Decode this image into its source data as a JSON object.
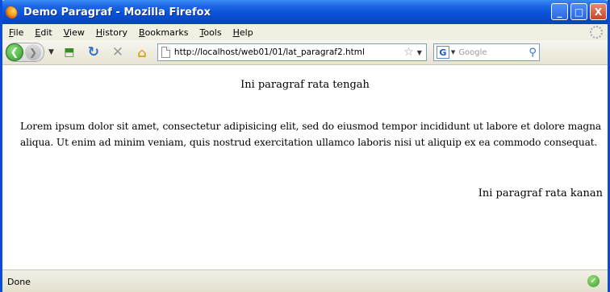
{
  "window": {
    "title": "Demo Paragraf - Mozilla Firefox",
    "controls": {
      "minimize": "_",
      "maximize": "□",
      "close": "X"
    }
  },
  "menu": [
    "File",
    "Edit",
    "View",
    "History",
    "Bookmarks",
    "Tools",
    "Help"
  ],
  "toolbar": {
    "url": "http://localhost/web01/01/lat_paragraf2.html",
    "search_placeholder": "Google",
    "search_engine_letter": "G",
    "icons": [
      "back-icon",
      "forward-icon",
      "history-dropdown-icon",
      "bookmark-add-icon",
      "reload-icon",
      "stop-icon",
      "home-icon",
      "page-icon",
      "star-icon",
      "url-dropdown-icon",
      "google-icon",
      "search-icon"
    ]
  },
  "content": {
    "p_center": "Ini paragraf rata tengah",
    "p_justify": "Lorem ipsum dolor sit amet, consectetur adipisicing elit, sed do eiusmod tempor incididunt ut labore et dolore magna aliqua. Ut enim ad minim veniam, quis nostrud exercitation ullamco laboris nisi ut aliquip ex ea commodo consequat.",
    "p_right": "Ini paragraf rata kanan"
  },
  "status": {
    "text": "Done"
  },
  "colors": {
    "titlebar": "#0a53d8",
    "frame": "#0a4bd8",
    "chrome": "#ece9d8"
  }
}
